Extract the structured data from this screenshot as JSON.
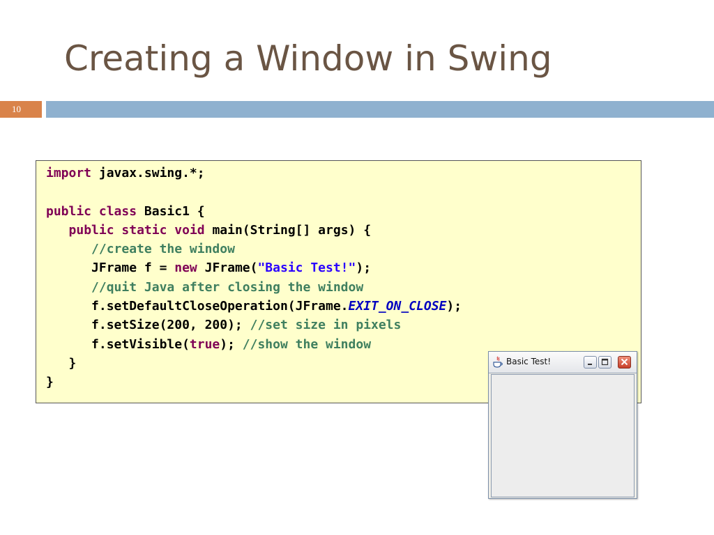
{
  "slide": {
    "title": "Creating a Window in Swing",
    "number": "10"
  },
  "code": {
    "l1_kw": "import",
    "l1_rest": " javax.swing.*;",
    "l3_kw1": "public",
    "l3_kw2": "class",
    "l3_rest": " Basic1 {",
    "l4_kw1": "public",
    "l4_kw2": "static",
    "l4_kw3": "void",
    "l4_rest": " main(String[] args) {",
    "l5_comment": "//create the window",
    "l6_a": "JFrame f = ",
    "l6_kw": "new",
    "l6_b": " JFrame(",
    "l6_str": "\"Basic Test!\"",
    "l6_c": ");",
    "l7_comment": "//quit Java after closing the window",
    "l8_a": "f.setDefaultCloseOperation(JFrame.",
    "l8_const": "EXIT_ON_CLOSE",
    "l8_b": ");",
    "l9_a": "f.setSize(200, 200); ",
    "l9_comment": "//set size in pixels",
    "l10_a": "f.setVisible(",
    "l10_kw": "true",
    "l10_b": "); ",
    "l10_comment": "//show the window",
    "l11": "}",
    "l12": "}"
  },
  "window": {
    "title": "Basic Test!",
    "app_icon": "java-icon",
    "button_icons": [
      "minimize-icon",
      "maximize-icon",
      "close-icon"
    ]
  },
  "colors": {
    "title": "#6a5544",
    "slide_number_bg": "#d9834a",
    "header_bar": "#8fb1cf",
    "code_bg": "#ffffcc",
    "keyword": "#7f0055",
    "comment": "#3f7f5f",
    "string": "#2a00ff",
    "constant": "#0000c0"
  }
}
